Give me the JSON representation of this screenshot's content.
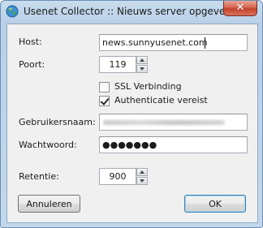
{
  "window": {
    "title": "Usenet Collector :: Nieuws server opgeven",
    "close_glyph": "✕"
  },
  "form": {
    "host": {
      "label": "Host:",
      "value": "news.sunnyusenet.com"
    },
    "port": {
      "label": "Poort:",
      "value": "119"
    },
    "ssl": {
      "label": "SSL Verbinding",
      "checked": false
    },
    "auth": {
      "label": "Authenticatie vereist",
      "checked": true
    },
    "username": {
      "label": "Gebruikersnaam:",
      "value": ""
    },
    "password": {
      "label": "Wachtwoord:",
      "value": "●●●●●●●"
    },
    "retention": {
      "label": "Retentie:",
      "value": "900"
    }
  },
  "buttons": {
    "cancel": "Annuleren",
    "ok": "OK"
  },
  "icons": {
    "app": "globe-icon",
    "close": "close-icon",
    "spin_up": "spin-up-icon",
    "spin_down": "spin-down-icon"
  },
  "colors": {
    "close_button": "#c4412b",
    "title_bar": "#b9d0e7",
    "default_button_border": "#3c7fb1"
  }
}
